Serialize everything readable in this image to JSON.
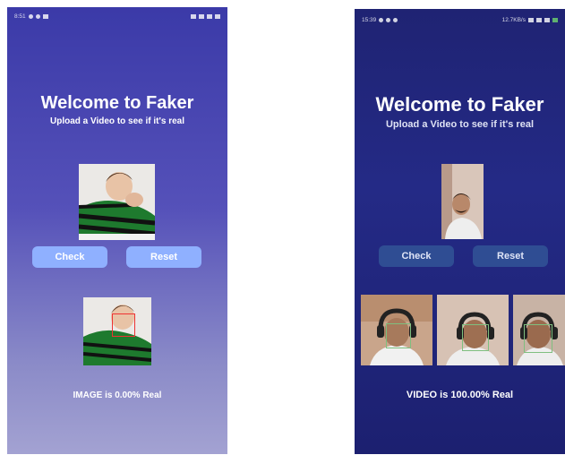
{
  "left_screen": {
    "status_time": "8:51",
    "title": "Welcome to Faker",
    "subtitle": "Upload a Video to see if it's real",
    "check_label": "Check",
    "reset_label": "Reset",
    "result_text": "IMAGE is 0.00% Real"
  },
  "right_screen": {
    "status_time": "15:39",
    "status_speed": "12.7KB/s",
    "title": "Welcome to Faker",
    "subtitle": "Upload a Video to see if it's real",
    "check_label": "Check",
    "reset_label": "Reset",
    "result_text": "VIDEO is 100.00% Real"
  }
}
